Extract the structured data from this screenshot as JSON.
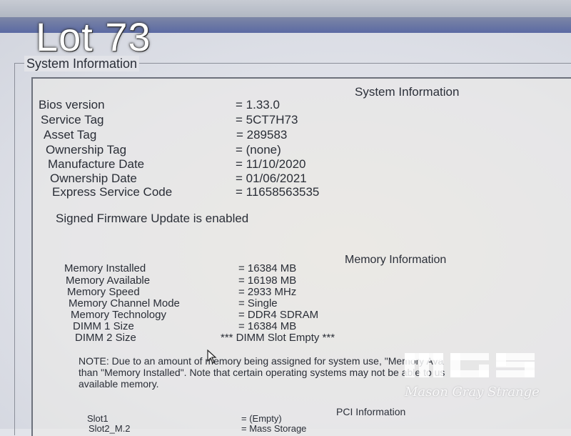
{
  "overlay": {
    "lot_label": "Lot 73"
  },
  "frame": {
    "legend": "System Information"
  },
  "system_info": {
    "heading": "System Information",
    "rows": [
      {
        "label": "Bios version",
        "value": "= 1.33.0"
      },
      {
        "label": "Service Tag",
        "value": "= 5CT7H73"
      },
      {
        "label": "Asset Tag",
        "value": "= 289583"
      },
      {
        "label": "Ownership Tag",
        "value": "= (none)"
      },
      {
        "label": "Manufacture Date",
        "value": "= 11/10/2020"
      },
      {
        "label": "Ownership Date",
        "value": "= 01/06/2021"
      },
      {
        "label": "Express Service Code",
        "value": "= 11658563535"
      }
    ],
    "firmware_status": "Signed Firmware Update is enabled"
  },
  "memory_info": {
    "heading": "Memory Information",
    "rows": [
      {
        "label": "Memory Installed",
        "value": "= 16384 MB"
      },
      {
        "label": "Memory Available",
        "value": "= 16198 MB"
      },
      {
        "label": "Memory Speed",
        "value": "= 2933 MHz"
      },
      {
        "label": "Memory Channel Mode",
        "value": "= Single"
      },
      {
        "label": "Memory Technology",
        "value": "= DDR4 SDRAM"
      },
      {
        "label": "DIMM 1 Size",
        "value": "= 16384 MB"
      },
      {
        "label": "DIMM 2 Size",
        "value": "*** DIMM Slot Empty ***"
      }
    ],
    "note_lines": [
      "NOTE: Due to an amount of memory being assigned for system use, \"Memory Ava",
      "than \"Memory Installed\". Note that certain operating systems may not be able to us",
      "available memory."
    ]
  },
  "pci_info": {
    "heading": "PCI Information",
    "rows": [
      {
        "label": "Slot1",
        "value": "= (Empty)"
      },
      {
        "label": "Slot2_M.2",
        "value": "= Mass Storage"
      }
    ]
  },
  "watermark": {
    "text": "Mason Gray Strange",
    "logo": "MGS"
  },
  "icons": {
    "cursor": "arrow-pointer-icon"
  },
  "colors": {
    "bios_text": "#2a2e37",
    "top_bar": "#5b6aa3",
    "screen_bg": "#e2e4ea"
  }
}
